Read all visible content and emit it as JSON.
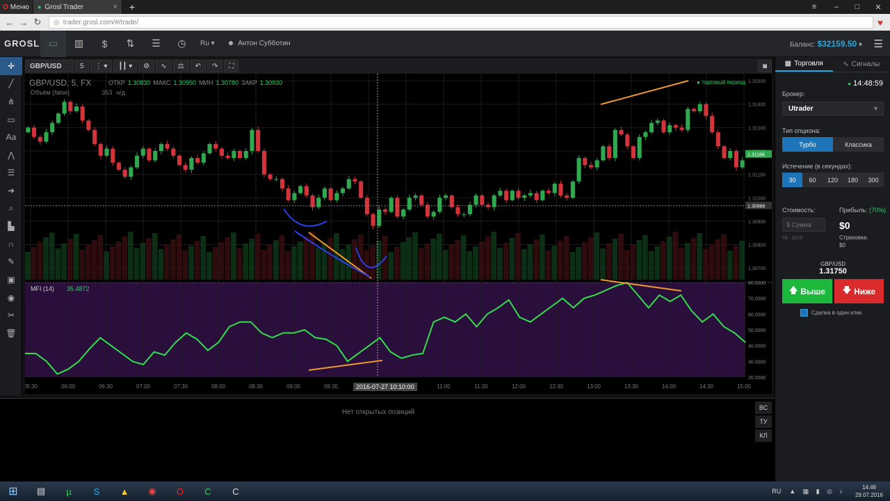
{
  "browser": {
    "menu_label": "Меню",
    "tab_title": "Grosl Trader",
    "url": "trader.grosl.com/#/trade/"
  },
  "header": {
    "logo": "GROSL",
    "lang": "Ru",
    "user": "Антон Субботин",
    "balance_label": "Баланс:",
    "balance_value": "$32159.50"
  },
  "chart_toolbar": {
    "symbol": "GBP/USD",
    "timeframe": "5"
  },
  "chart_data": {
    "type": "candlestick",
    "title": "GBP/USD, 5, FX",
    "ohlc_labels": {
      "open_label": "ОТКР",
      "open": "1.30830",
      "high_label": "МАКС",
      "high": "1.30950",
      "low_label": "МИН",
      "low": "1.30780",
      "close_label": "ЗАКР",
      "close": "1.30930"
    },
    "volume_label": "Объём (false)",
    "volume_value": "353",
    "volume_na": "н/д",
    "period_label": "торговый период",
    "ylabels": [
      "1.31500",
      "1.31400",
      "1.31300",
      "1.31200",
      "1.31100",
      "1.31000",
      "1.30900",
      "1.30800",
      "1.30700"
    ],
    "ylim": [
      1.3065,
      1.3153
    ],
    "current_price_tag": "1.31186",
    "cursor_price_tag": "1.30966",
    "xlabels": [
      "05:30",
      "06:00",
      "06:30",
      "07:00",
      "07:30",
      "08:00",
      "08:30",
      "09:00",
      "09:30",
      "10:00",
      "10:30",
      "11:00",
      "11:30",
      "12:00",
      "12:30",
      "13:00",
      "13:30",
      "14:00",
      "14:30",
      "15:00"
    ],
    "crosshair_time": "2016-07-27 10:10:00",
    "closes": [
      1.313,
      1.3126,
      1.3124,
      1.3128,
      1.3132,
      1.3136,
      1.3141,
      1.3137,
      1.3139,
      1.3133,
      1.3129,
      1.3123,
      1.3118,
      1.3121,
      1.3115,
      1.3112,
      1.3109,
      1.3113,
      1.3118,
      1.3121,
      1.3116,
      1.312,
      1.3123,
      1.3121,
      1.3118,
      1.3114,
      1.3112,
      1.3117,
      1.3115,
      1.3119,
      1.3123,
      1.3121,
      1.3118,
      1.3117,
      1.312,
      1.3117,
      1.312,
      1.3129,
      1.312,
      1.311,
      1.3108,
      1.3108,
      1.3104,
      1.3099,
      1.3102,
      1.3105,
      1.3101,
      1.3096,
      1.31,
      1.3104,
      1.3099,
      1.3102,
      1.3104,
      1.3108,
      1.3107,
      1.31,
      1.3093,
      1.3088,
      1.3095,
      1.3094,
      1.31,
      1.3092,
      1.3095,
      1.31,
      1.3101,
      1.3097,
      1.3092,
      1.3094,
      1.31,
      1.3101,
      1.3096,
      1.3093,
      1.3093,
      1.3097,
      1.3101,
      1.3097,
      1.3096,
      1.3101,
      1.3103,
      1.3099,
      1.3103,
      1.31,
      1.3101,
      1.3102,
      1.3099,
      1.3103,
      1.3102,
      1.3106,
      1.3101,
      1.31,
      1.3107,
      1.3117,
      1.3114,
      1.3113,
      1.3116,
      1.3122,
      1.3117,
      1.3129,
      1.3127,
      1.3122,
      1.3117,
      1.3126,
      1.3128,
      1.3132,
      1.3133,
      1.3128,
      1.3131,
      1.313,
      1.3129,
      1.3138,
      1.3137,
      1.314,
      1.3135,
      1.3128,
      1.3122,
      1.3117,
      1.312,
      1.3113,
      1.3116
    ],
    "indicator": {
      "label": "MFI (14)",
      "value": "35.4872",
      "ylabels": [
        "80.0000",
        "70.0000",
        "60.0000",
        "50.0000",
        "40.0000",
        "30.0000",
        "20.0000"
      ],
      "ylim": [
        20,
        80
      ],
      "values": [
        35,
        35,
        30,
        22,
        25,
        30,
        38,
        45,
        40,
        35,
        30,
        28,
        36,
        34,
        42,
        48,
        44,
        37,
        42,
        52,
        55,
        55,
        48,
        45,
        48,
        48,
        50,
        45,
        44,
        40,
        30,
        35,
        40,
        45,
        36,
        32,
        34,
        35,
        55,
        58,
        55,
        60,
        52,
        60,
        64,
        69,
        58,
        55,
        60,
        65,
        70,
        64,
        70,
        72,
        75,
        78,
        80,
        72,
        64,
        72,
        68,
        72,
        62,
        55,
        60,
        52,
        48,
        42
      ]
    },
    "grid": true
  },
  "positions": {
    "empty_text": "Нет открытых позиций",
    "tabs": [
      "ВС",
      "ТУ",
      "КЛ"
    ]
  },
  "panel": {
    "tab_trading": "Торговля",
    "tab_signals": "Сигналы",
    "time": "14:48:59",
    "broker_label": "Брокер:",
    "broker_value": "Utrader",
    "option_type_label": "Тип опциона:",
    "option_types": [
      "Турбо",
      "Классика"
    ],
    "expiry_label": "Истечение (в секундах):",
    "expiries": [
      "30",
      "60",
      "120",
      "180",
      "300"
    ],
    "cost_label": "Стоимость:",
    "sum_placeholder": "$ Сумма",
    "range": "5$ - $500",
    "profit_label": "Прибыль:",
    "profit_pct": "(70%)",
    "profit_value": "$0",
    "insurance_label": "Страховка:",
    "insurance_value": "$0",
    "pair": "GBP/USD",
    "price": "1.31750",
    "up_label": "Выше",
    "down_label": "Ниже",
    "oneclick_label": "Сделка в один клик"
  },
  "taskbar": {
    "lang": "RU",
    "time": "14:48",
    "date": "29.07.2016"
  }
}
